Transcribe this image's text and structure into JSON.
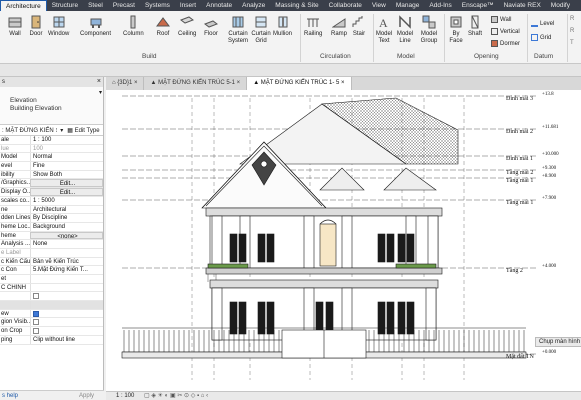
{
  "ribbon_tabs": [
    "Architecture",
    "Structure",
    "Steel",
    "Precast",
    "Systems",
    "Insert",
    "Annotate",
    "Analyze",
    "Massing & Site",
    "Collaborate",
    "View",
    "Manage",
    "Add-Ins",
    "Enscape™",
    "Naviate REX",
    "Modify"
  ],
  "ribbon": {
    "build": {
      "wall": "Wall",
      "door": "Door",
      "window": "Window",
      "component": "Component",
      "column": "Column",
      "roof": "Roof",
      "ceiling": "Ceiling",
      "floor": "Floor",
      "curtain_system": "Curtain System",
      "curtain_grid": "Curtain Grid",
      "mullion": "Mullion",
      "group": "Build"
    },
    "circulation": {
      "railing": "Railing",
      "ramp": "Ramp",
      "stair": "Stair",
      "group": "Circulation"
    },
    "model": {
      "model_text": "Model Text",
      "model_line": "Model Line",
      "model_group": "Model Group",
      "group": "Model"
    },
    "opening": {
      "by_face": "By Face",
      "shaft": "Shaft",
      "wall": "Wall",
      "vertical": "Vertical",
      "dormer": "Dormer",
      "group": "Opening"
    },
    "datum": {
      "level": "Level",
      "grid": "Grid",
      "group": "Datum"
    }
  },
  "properties": {
    "type_line1": "Elevation",
    "type_line2": "Building Elevation",
    "selector": ": MẶT ĐỨNG KIẾN ⁝",
    "edit_type": "Edit Type",
    "rows": [
      {
        "k": "ale",
        "v": "1 : 100"
      },
      {
        "k": "lue",
        "v": "100",
        "grey": true
      },
      {
        "k": "Model",
        "v": "Normal"
      },
      {
        "k": "evel",
        "v": "Fine"
      },
      {
        "k": "ibility",
        "v": "Show Both"
      },
      {
        "k": "/Graphics...",
        "v": "Edit...",
        "btn": true
      },
      {
        "k": "Display O...",
        "v": "Edit...",
        "btn": true
      },
      {
        "k": "scales co...",
        "v": "1 : 5000"
      },
      {
        "k": "ne",
        "v": "Architectural"
      },
      {
        "k": "dden Lines",
        "v": "By Discipline"
      },
      {
        "k": "heme Loc...",
        "v": "Background"
      },
      {
        "k": "heme",
        "v": "<none>",
        "btn": true
      },
      {
        "k": "Analysis ...",
        "v": "None"
      },
      {
        "k": "e Label",
        "v": "",
        "grey": true
      },
      {
        "k": "c Kiến Cấu",
        "v": "Bản vẽ Kiến Trúc"
      },
      {
        "k": "c Con",
        "v": "5.Mặt Đứng Kiến T..."
      },
      {
        "k": "et",
        "v": ""
      },
      {
        "k": "C CHINH",
        "v": ""
      },
      {
        "k": "",
        "v": "",
        "check": false
      },
      {
        "k": "",
        "v": "",
        "group": true
      },
      {
        "k": "ew",
        "v": "",
        "check": true
      },
      {
        "k": "gion Visib...",
        "v": "",
        "check": false
      },
      {
        "k": "on Crop",
        "v": "",
        "check": false
      },
      {
        "k": "ping",
        "v": "Clip without line"
      }
    ],
    "help": "s help",
    "apply": "Apply"
  },
  "view_tabs": [
    "{3D}1",
    "MẶT ĐỨNG KIẾN TRÚC 5-1",
    "MẶT ĐỨNG KIẾN TRÚC 1- 5"
  ],
  "levels": [
    {
      "name": "Đỉnh mái 3",
      "value": "+13.8"
    },
    {
      "name": "Đỉnh mái 2",
      "value": "+11.681"
    },
    {
      "name": "Đỉnh mái 1",
      "value": "+10.000"
    },
    {
      "name": "Tầng mái 2",
      "value": "+9.300"
    },
    {
      "name": "Tầng mái 1",
      "value": "+8.900"
    },
    {
      "name": "Tầng mái 1",
      "value": "+7.900"
    },
    {
      "name": "Tầng 2",
      "value": "+4.000"
    },
    {
      "name": "Mặt đất TN",
      "value": "+0.000"
    }
  ],
  "status": {
    "scale": "1 : 100"
  },
  "tooltip": "Chụp màn hình",
  "colors": {
    "tabbar": "#3a3f4a",
    "active_tab_border": "#1f5aa8",
    "drawing": "#1a1a1a",
    "level_line": "#333333"
  }
}
